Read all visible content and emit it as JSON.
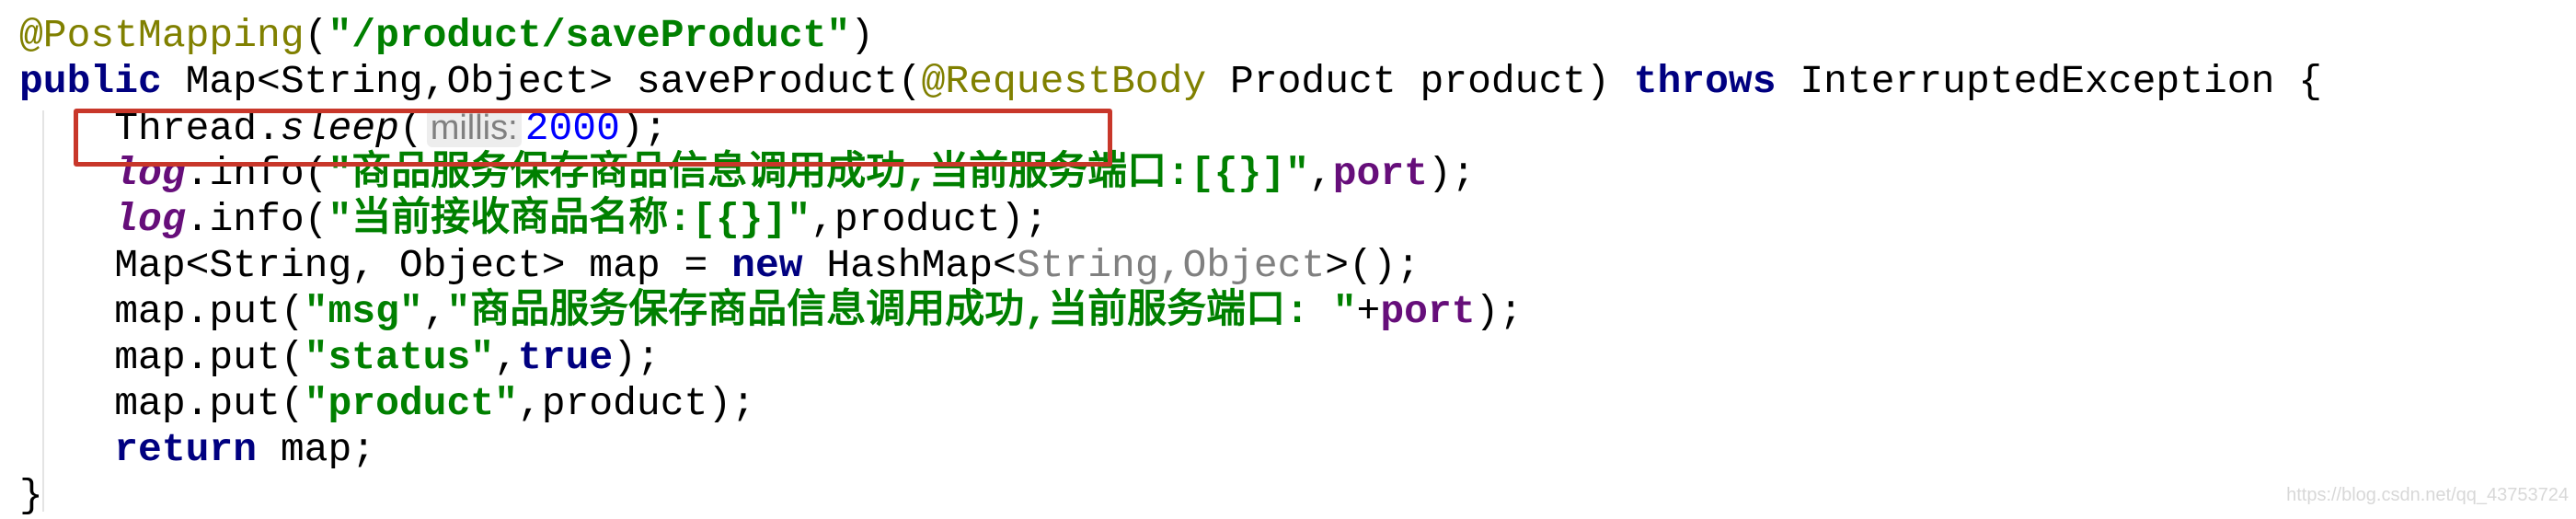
{
  "colors": {
    "annotation": "#808000",
    "string": "#008000",
    "keyword": "#000080",
    "field": "#660E7A",
    "number": "#0000FF",
    "highlight_box": "#C8372A"
  },
  "code_lines": [
    [
      {
        "t": "@PostMapping",
        "c": "annotation"
      },
      {
        "t": "("
      },
      {
        "t": "\"/product/saveProduct\"",
        "c": "string"
      },
      {
        "t": ")"
      }
    ],
    [
      {
        "t": "public",
        "c": "keyword"
      },
      {
        "t": " Map<String,Object> saveProduct("
      },
      {
        "t": "@RequestBody",
        "c": "annotation"
      },
      {
        "t": " Product product) "
      },
      {
        "t": "throws",
        "c": "keyword"
      },
      {
        "t": " InterruptedException {"
      }
    ],
    [
      {
        "t": "    Thread."
      },
      {
        "t": "sleep",
        "c": "method-static"
      },
      {
        "t": "("
      },
      {
        "t": "millis:",
        "c": "hint"
      },
      {
        "t": "2000",
        "c": "number"
      },
      {
        "t": ");"
      }
    ],
    [
      {
        "t": "    "
      },
      {
        "t": "log",
        "c": "static-field"
      },
      {
        "t": ".info("
      },
      {
        "t": "\"商品服务保存商品信息调用成功,当前服务端口:[{}]\"",
        "c": "string"
      },
      {
        "t": ","
      },
      {
        "t": "port",
        "c": "field"
      },
      {
        "t": ");"
      }
    ],
    [
      {
        "t": "    "
      },
      {
        "t": "log",
        "c": "static-field"
      },
      {
        "t": ".info("
      },
      {
        "t": "\"当前接收商品名称:[{}]\"",
        "c": "string"
      },
      {
        "t": ",product);"
      }
    ],
    [
      {
        "t": "    Map<String, Object> map = "
      },
      {
        "t": "new",
        "c": "keyword"
      },
      {
        "t": " HashMap<"
      },
      {
        "t": "String,Object",
        "c": "generic-gray"
      },
      {
        "t": ">();"
      }
    ],
    [
      {
        "t": "    map.put("
      },
      {
        "t": "\"msg\"",
        "c": "string"
      },
      {
        "t": ","
      },
      {
        "t": "\"商品服务保存商品信息调用成功,当前服务端口: \"",
        "c": "string"
      },
      {
        "t": "+"
      },
      {
        "t": "port",
        "c": "field"
      },
      {
        "t": ");"
      }
    ],
    [
      {
        "t": "    map.put("
      },
      {
        "t": "\"status\"",
        "c": "string"
      },
      {
        "t": ","
      },
      {
        "t": "true",
        "c": "keyword"
      },
      {
        "t": ");"
      }
    ],
    [
      {
        "t": "    map.put("
      },
      {
        "t": "\"product\"",
        "c": "string"
      },
      {
        "t": ",product);"
      }
    ],
    [
      {
        "t": "    "
      },
      {
        "t": "return",
        "c": "keyword"
      },
      {
        "t": " map;"
      }
    ],
    [
      {
        "t": "}"
      }
    ]
  ],
  "watermark": "https://blog.csdn.net/qq_43753724"
}
